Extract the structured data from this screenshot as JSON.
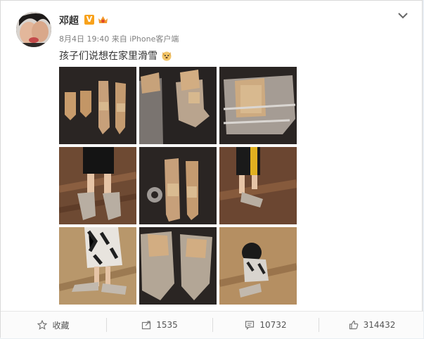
{
  "post": {
    "author": "邓超",
    "verified_badge": "V",
    "date": "8月4日 19:40",
    "source_prefix": "来自",
    "source": "iPhone客户端",
    "text": "孩子们说想在家里滑雪",
    "text_emoji": "dog-face-emoji"
  },
  "photos": [
    {
      "alt": "cardboard-ski-cutouts-on-floor"
    },
    {
      "alt": "cardboard-ski-boots-taped"
    },
    {
      "alt": "taped-cardboard-ski-closeup"
    },
    {
      "alt": "child-wearing-cardboard-skis"
    },
    {
      "alt": "cardboard-skis-with-tape-roll"
    },
    {
      "alt": "child-walking-on-cardboard-skis"
    },
    {
      "alt": "child-in-dress-on-cardboard-skis"
    },
    {
      "alt": "pair-of-cardboard-ski-boots"
    },
    {
      "alt": "child-crouching-on-cardboard-skis"
    }
  ],
  "actions": {
    "favorite_label": "收藏",
    "repost_count": "1535",
    "comment_count": "10732",
    "like_count": "314432"
  },
  "icons": {
    "menu": "chevron-down-icon",
    "favorite": "star-icon",
    "repost": "share-icon",
    "comment": "comment-icon",
    "like": "thumbs-up-icon"
  },
  "colors": {
    "badge": "#f8a21c",
    "meta_text": "#808080",
    "background": "#e9eef3"
  }
}
